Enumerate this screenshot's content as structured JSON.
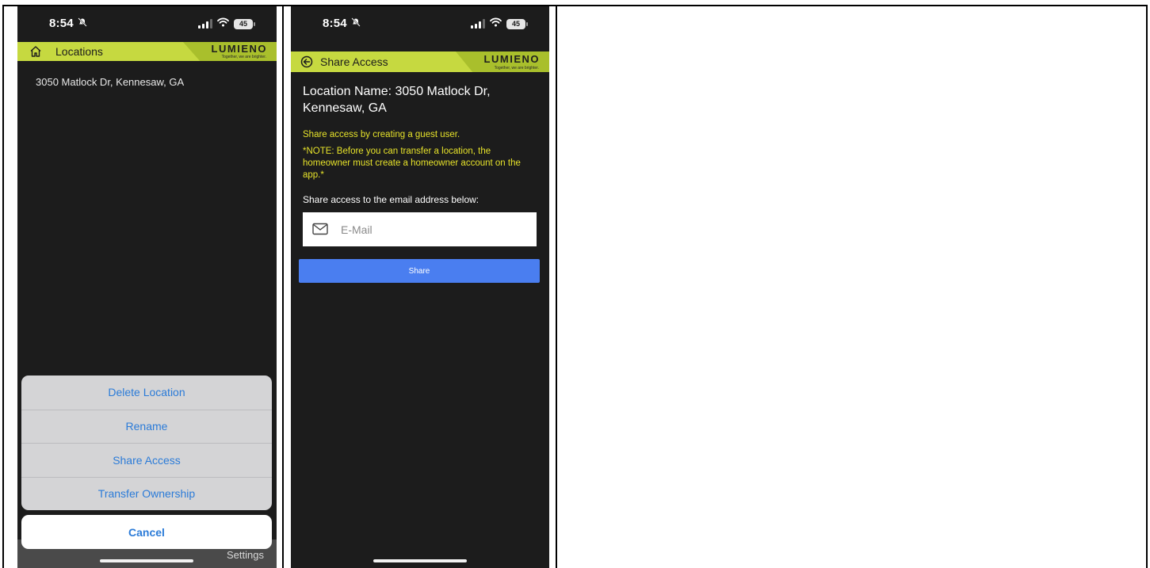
{
  "phone1": {
    "status": {
      "time": "8:54",
      "battery": "45"
    },
    "header": {
      "title": "Locations",
      "logo": "LUMIENO",
      "tagline": "Together, we are brighter."
    },
    "address": "3050 Matlock Dr, Kennesaw, GA",
    "action_sheet": {
      "items": [
        "Delete Location",
        "Rename",
        "Share Access",
        "Transfer Ownership"
      ],
      "cancel": "Cancel"
    },
    "tabbar": {
      "settings": "Settings"
    }
  },
  "phone2": {
    "status": {
      "time": "8:54",
      "battery": "45"
    },
    "header": {
      "title": "Share Access",
      "logo": "LUMIENO",
      "tagline": "Together, we are brighter."
    },
    "location_name": "Location Name: 3050 Matlock Dr, Kennesaw, GA",
    "info": "Share access by creating a guest user.",
    "note": "*NOTE: Before you can transfer a location, the homeowner must create a homeowner account on the app.*",
    "share_label": "Share access to the email address below:",
    "email": {
      "placeholder": "E-Mail",
      "value": ""
    },
    "share_button": "Share"
  },
  "colors": {
    "header_green": "#c6d940",
    "app_background": "#1c1c1c",
    "note_yellow": "#e6e22a",
    "ios_blue": "#2b7bd8",
    "button_blue": "#4a7ef0"
  },
  "icons": {
    "phone1_header": "home-icon",
    "phone2_header": "back-arrow-icon",
    "email_field": "mail-icon"
  }
}
